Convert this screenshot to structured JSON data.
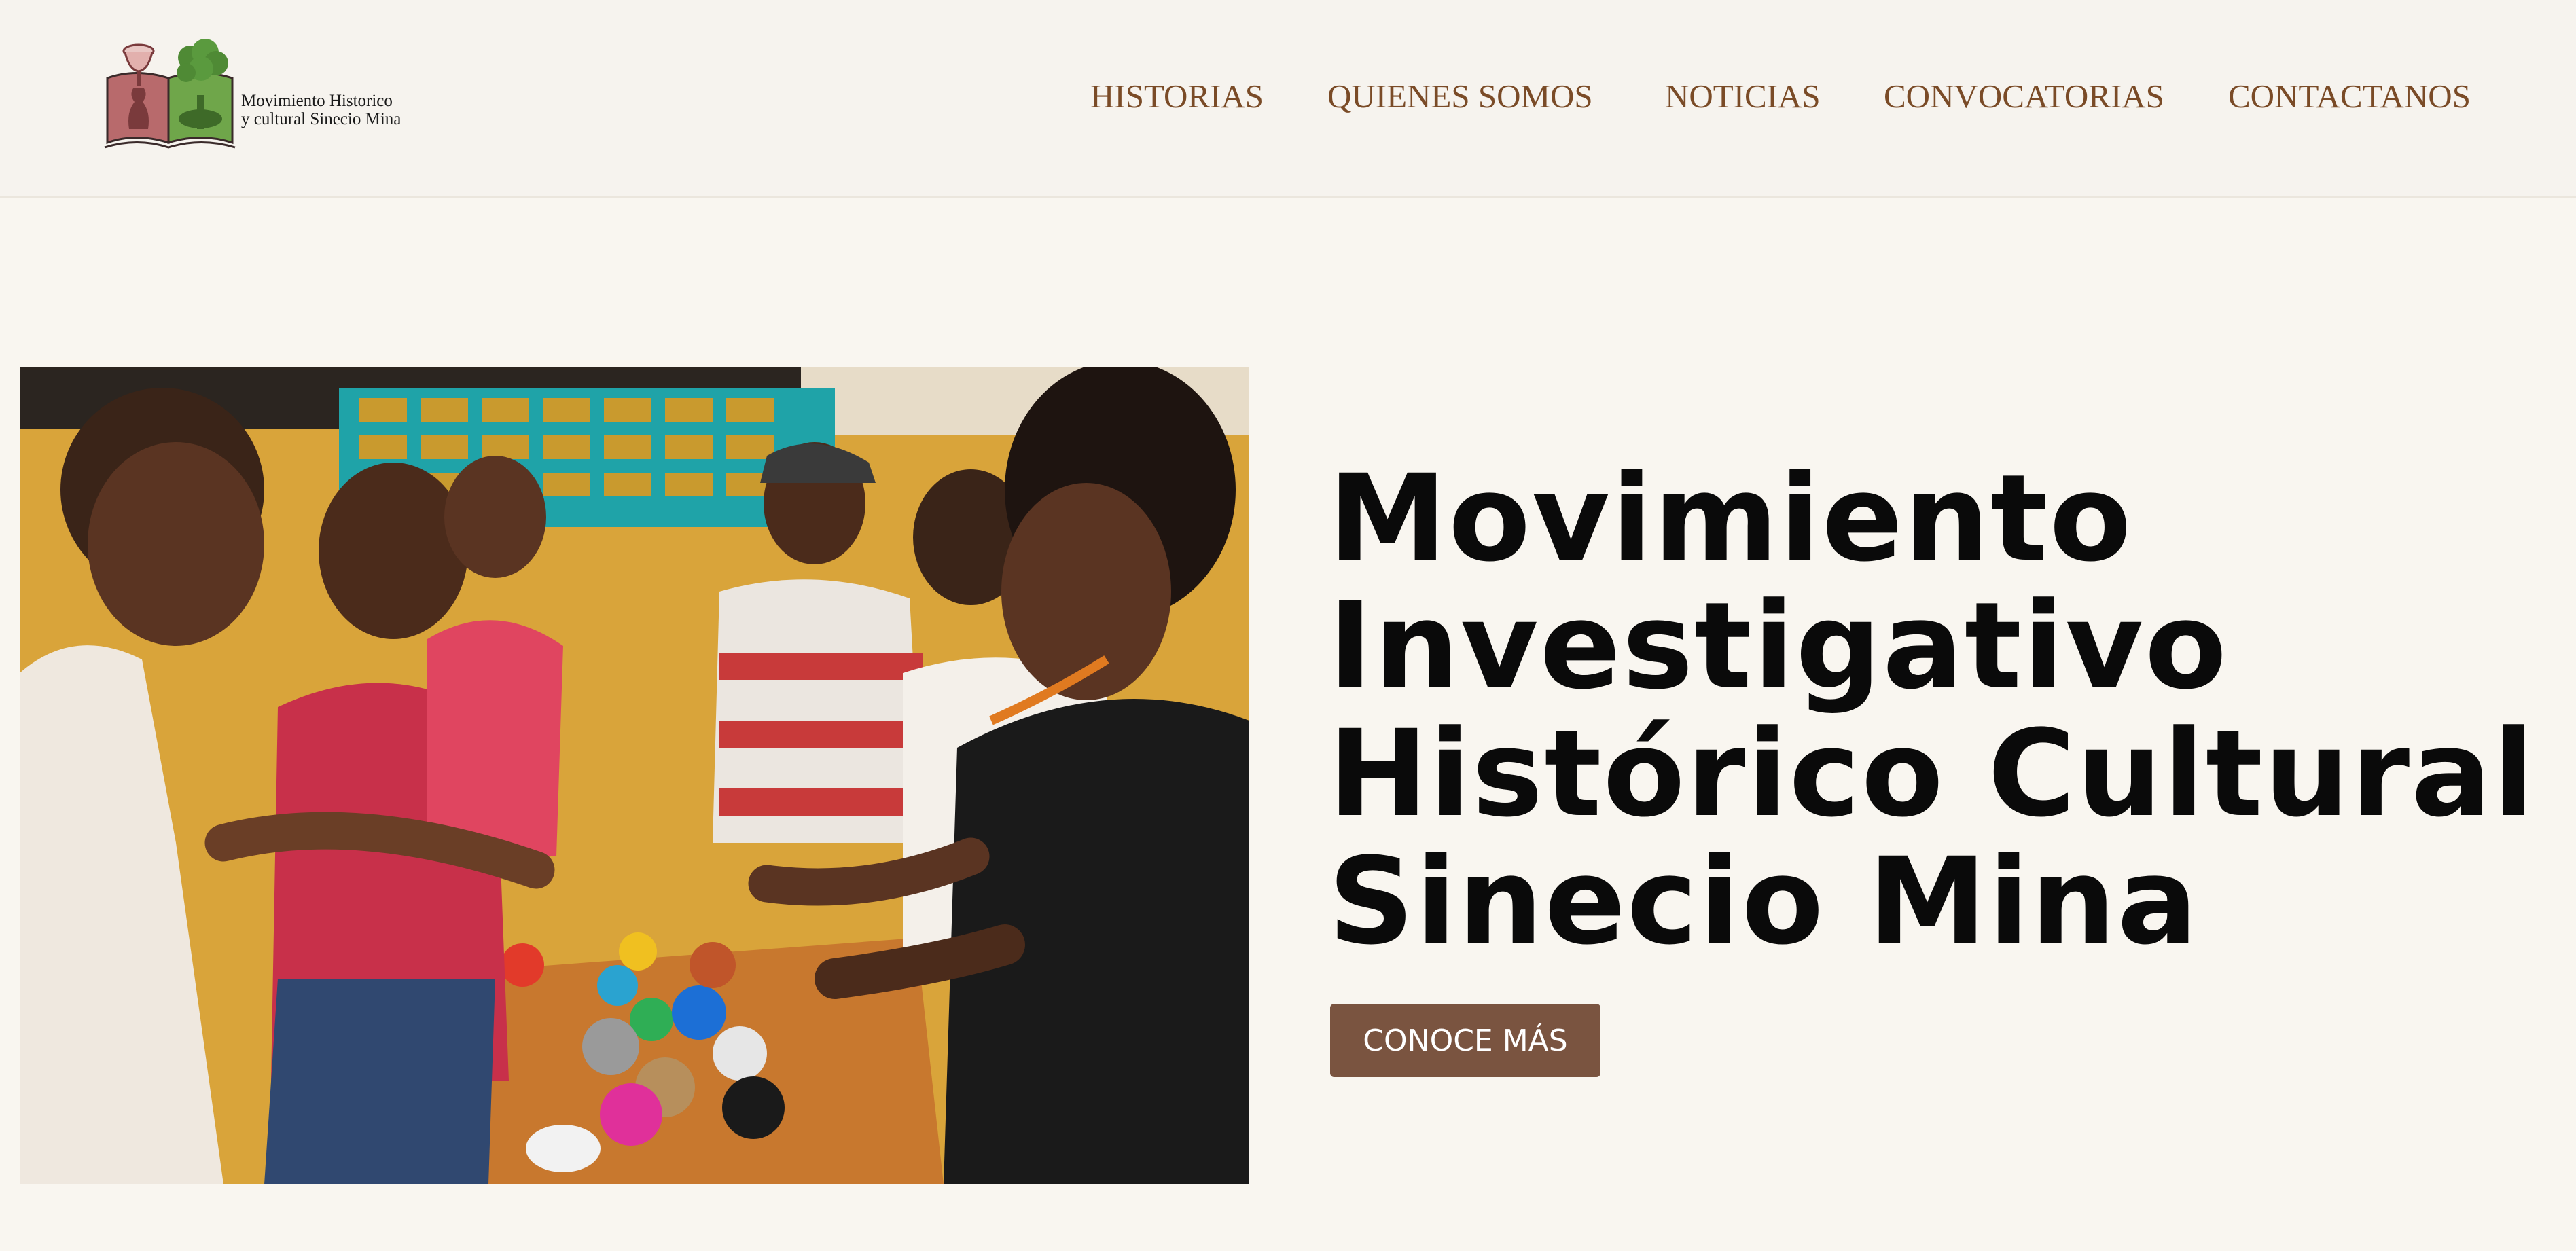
{
  "logo": {
    "line1": "Movimiento Historico",
    "line2": "y cultural Sinecio Mina"
  },
  "nav": {
    "items": [
      {
        "label": "HISTORIAS"
      },
      {
        "label": "QUIENES SOMOS"
      },
      {
        "label": "NOTICIAS"
      },
      {
        "label": "CONVOCATORIAS"
      },
      {
        "label": "CONTACTANOS"
      }
    ]
  },
  "hero": {
    "title_lines": [
      "Movimiento",
      "Investigativo",
      "Histórico Cultural",
      "Sinecio Mina"
    ],
    "cta_label": "CONOCE MÁS"
  },
  "colors": {
    "background": "#f9f6f0",
    "nav_text": "#7a4b27",
    "cta_background": "#7a5440",
    "title_text": "#0a0a0a"
  }
}
